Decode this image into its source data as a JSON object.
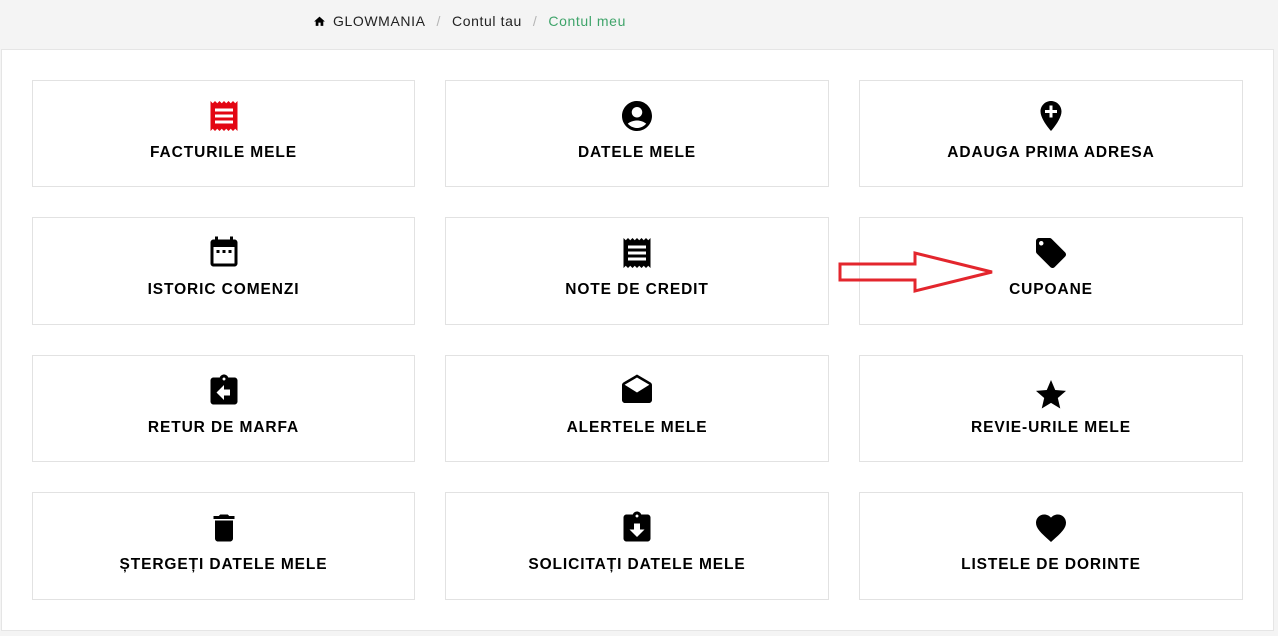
{
  "breadcrumb": {
    "home": "GLOWMANIA",
    "account": "Contul tau",
    "current": "Contul meu",
    "separator": "/"
  },
  "tiles": [
    {
      "label": "FACTURILE MELE",
      "icon": "receipt-icon",
      "color": "#e30613"
    },
    {
      "label": "DATELE MELE",
      "icon": "account-circle-icon",
      "color": "#000000"
    },
    {
      "label": "ADAUGA PRIMA ADRESA",
      "icon": "add-location-icon",
      "color": "#000000"
    },
    {
      "label": "ISTORIC COMENZI",
      "icon": "calendar-icon",
      "color": "#000000"
    },
    {
      "label": "NOTE DE CREDIT",
      "icon": "receipt-icon",
      "color": "#000000"
    },
    {
      "label": "CUPOANE",
      "icon": "tag-icon",
      "color": "#000000"
    },
    {
      "label": "RETUR DE MARFA",
      "icon": "return-clipboard-icon",
      "color": "#000000"
    },
    {
      "label": "ALERTELE MELE",
      "icon": "open-envelope-icon",
      "color": "#000000"
    },
    {
      "label": "REVIE-URILE MELE",
      "icon": "star-icon",
      "color": "#000000"
    },
    {
      "label": "ȘTERGEȚI DATELE MELE",
      "icon": "trash-icon",
      "color": "#000000"
    },
    {
      "label": "SOLICITAȚI DATELE MELE",
      "icon": "download-clipboard-icon",
      "color": "#000000"
    },
    {
      "label": "LISTELE DE DORINTE",
      "icon": "heart-icon",
      "color": "#000000"
    }
  ],
  "annotation": {
    "arrow_color": "#e3262d",
    "points_to": "CUPOANE"
  }
}
